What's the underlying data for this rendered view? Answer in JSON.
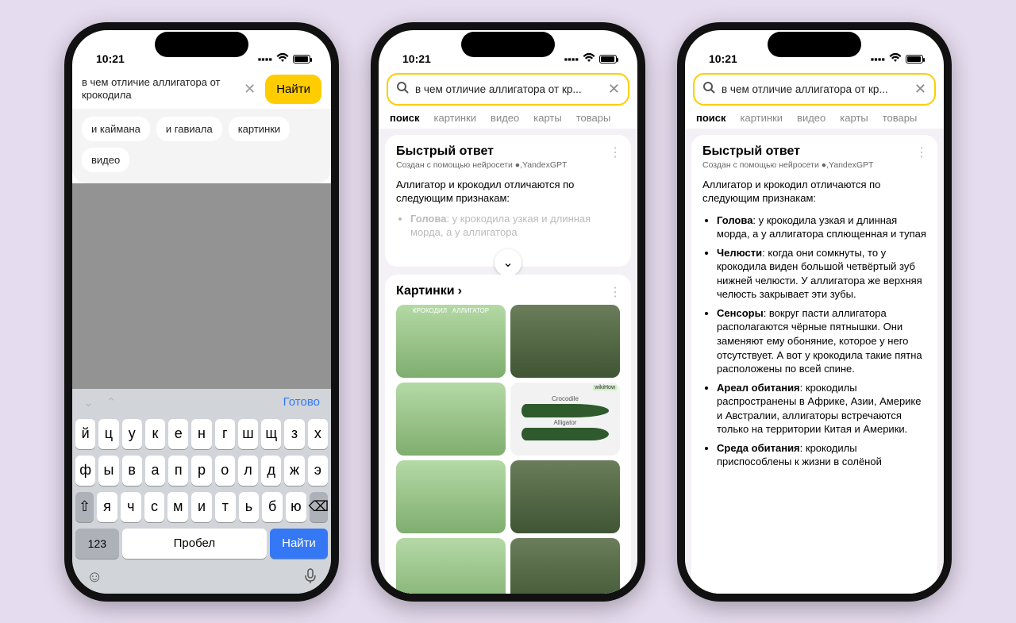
{
  "status": {
    "time": "10:21"
  },
  "phone1": {
    "search_query": "в чем отличие аллигатора от крокодила",
    "find_button": "Найти",
    "chips": [
      "и каймана",
      "и гавиала",
      "картинки",
      "видео"
    ],
    "kb": {
      "done": "Готово",
      "row1": [
        "й",
        "ц",
        "у",
        "к",
        "е",
        "н",
        "г",
        "ш",
        "щ",
        "з",
        "х"
      ],
      "row2": [
        "ф",
        "ы",
        "в",
        "а",
        "п",
        "р",
        "о",
        "л",
        "д",
        "ж",
        "э"
      ],
      "row3": [
        "я",
        "ч",
        "с",
        "м",
        "и",
        "т",
        "ь",
        "б",
        "ю"
      ],
      "numkey": "123",
      "space": "Пробел",
      "search": "Найти"
    }
  },
  "shared": {
    "query_display": "в чем отличие аллигатора от кр...",
    "tabs": [
      "поиск",
      "картинки",
      "видео",
      "карты",
      "товары"
    ],
    "quick_title": "Быстрый ответ",
    "quick_sub_prefix": "Создан с помощью нейросети ",
    "quick_sub_model": "YandexGPT",
    "intro": "Аллигатор и крокодил отличаются по следующим признакам:",
    "images_title": "Картинки",
    "img_labels": {
      "croc": "КРОКОДИЛ",
      "alli": "АЛЛИГАТОР",
      "croc2": "Crocodile",
      "alli2": "Alligator",
      "wiki": "wikiHow"
    }
  },
  "phone2": {
    "bullets": [
      {
        "label": "Голова",
        "text": ": у крокодила узкая и длинная морда, а у аллигатора",
        "faded": true
      }
    ]
  },
  "phone3": {
    "bullets": [
      {
        "label": "Голова",
        "text": ": у крокодила узкая и длинная морда, а у аллигатора сплющенная и тупая"
      },
      {
        "label": "Челюсти",
        "text": ": когда они сомкнуты, то у крокодила виден большой четвёртый зуб нижней челюсти. У аллигатора же верхняя челюсть закрывает эти зубы."
      },
      {
        "label": "Сенсоры",
        "text": ": вокруг пасти аллигатора располагаются чёрные пятнышки. Они заменяют ему обоняние, которое у него отсутствует. А вот у крокодила такие пятна расположены по всей спине."
      },
      {
        "label": "Ареал обитания",
        "text": ": крокодилы распространены в Африке, Азии, Америке и Австралии, аллигаторы встречаются только на территории Китая и Америки."
      },
      {
        "label": "Среда обитания",
        "text": ": крокодилы приспособлены к жизни в солёной"
      }
    ]
  }
}
